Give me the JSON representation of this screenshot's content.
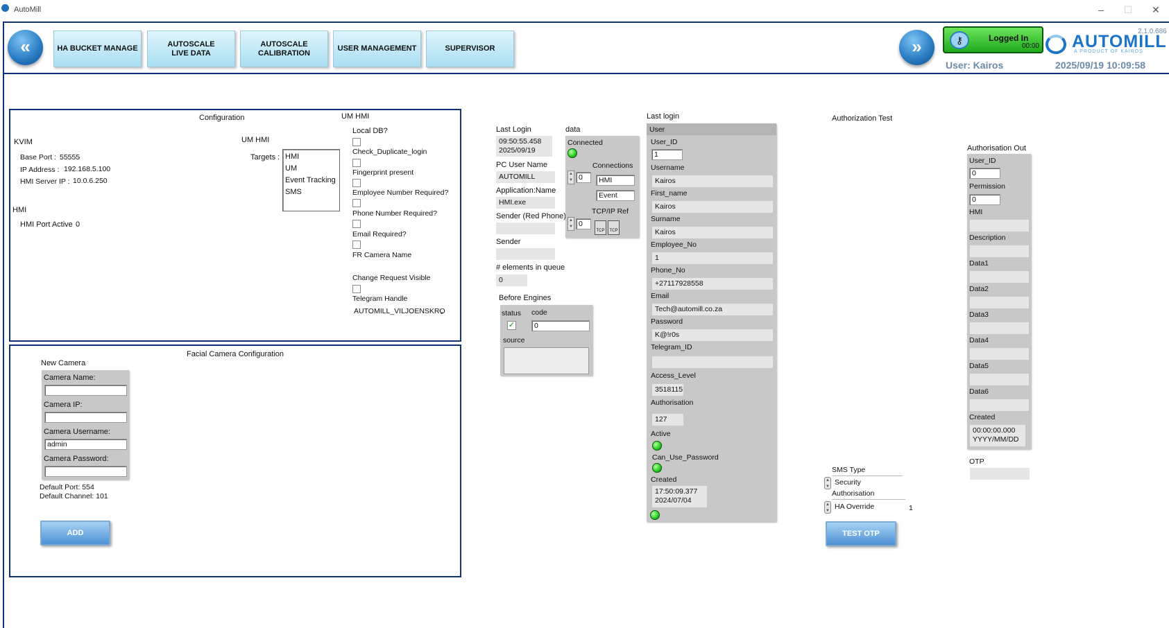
{
  "window": {
    "title": "AutoMill",
    "min": "–",
    "max": "☐",
    "close": "✕"
  },
  "header": {
    "tabs": [
      "HA BUCKET MANAGE",
      "AUTOSCALE\nLIVE DATA",
      "AUTOSCALE\nCALIBRATION",
      "USER MANAGEMENT",
      "SUPERVISOR"
    ],
    "login_status": "Logged In",
    "login_time": "00:00",
    "user_label": "User: Kairos",
    "datetime": "2025/09/19 10:09:58",
    "version": "2.1.0.686",
    "logo": "AUTOMILL",
    "logo_sub": "A PRODUCT OF KAIROS"
  },
  "config": {
    "title": "Configuration",
    "kvim": "KVIM",
    "base_port_label": "Base Port :",
    "base_port": "55555",
    "ip_label": "IP Address :",
    "ip": "192.168.5.100",
    "server_ip_label": "HMI Server IP :",
    "server_ip": "10.0.6.250",
    "hmi": "HMI",
    "hmi_port_label": "HMI Port Active",
    "hmi_port": "0",
    "um_hmi_label": "UM HMI",
    "targets_label": "Targets :",
    "targets": [
      "HMI",
      "UM",
      "Event Tracking",
      "SMS"
    ],
    "um_hmi_title": "UM HMI",
    "local_db": "Local DB?",
    "check_dup": "Check_Duplicate_login",
    "fingerprint": "Fingerprint present",
    "emp_req": "Employee Number Required?",
    "phone_req": "Phone Number Required?",
    "email_req": "Email Required?",
    "fr_cam": "FR Camera Name",
    "change_req": "Change Request Visible",
    "telegram": "Telegram Handle",
    "telegram_val": "AUTOMILL_VILJOENSKRO"
  },
  "facial": {
    "title": "Facial Camera Configuration",
    "new_camera": "New Camera",
    "cam_name": "Camera Name:",
    "cam_ip": "Camera IP:",
    "cam_user": "Camera Username:",
    "cam_user_val": "admin",
    "cam_pass": "Camera Password:",
    "default_port": "Default Port: 554",
    "default_channel": "Default Channel: 101",
    "add": "ADD"
  },
  "mid": {
    "last_login": "Last Login",
    "last_login_time": "09:50:55.458",
    "last_login_date": "2025/09/19",
    "pc_user_label": "PC User Name",
    "pc_user": "AUTOMILL",
    "app_name_label": "Application:Name",
    "app_name": "HMI.exe",
    "sender_red": "Sender (Red Phone)",
    "sender": "Sender",
    "queue_label": "# elements in queue",
    "queue": "0",
    "before_engines": "Before Engines",
    "status": "status",
    "code": "code",
    "code_val": "0",
    "source": "source",
    "check": "✓"
  },
  "data": {
    "title": "data",
    "connected": "Connected",
    "connections": "Connections",
    "conn_index": "0",
    "conn1": "HMI",
    "conn2": "Event",
    "tcp_label": "TCP/IP Ref",
    "tcp_index": "0",
    "tcp": "TCP"
  },
  "lastlogin": {
    "title": "Last login",
    "user": "User",
    "user_id_label": "User_ID",
    "user_id": "1",
    "username_label": "Username",
    "username": "Kairos",
    "first_label": "First_name",
    "first": "Kairos",
    "surname_label": "Surname",
    "surname": "Kairos",
    "emp_label": "Employee_No",
    "emp": "1",
    "phone_label": "Phone_No",
    "phone": "+27117928558",
    "email_label": "Email",
    "email": "Tech@automill.co.za",
    "pass_label": "Password",
    "pass": "K@!r0s",
    "tg_label": "Telegram_ID",
    "access_label": "Access_Level",
    "access": "3518115",
    "auth_label": "Authorisation",
    "auth": "127",
    "active_label": "Active",
    "canuse_label": "Can_Use_Password",
    "created_label": "Created",
    "created_time": "17:50:09.377",
    "created_date": "2024/07/04"
  },
  "authtest": {
    "title": "Authorization Test",
    "sms_type": "SMS Type",
    "sms_val": "Security",
    "auth": "Authorisation",
    "auth_val": "HA Override",
    "auth_num": "1",
    "test_otp": "TEST OTP"
  },
  "authout": {
    "title": "Authorisation Out",
    "user_id_label": "User_ID",
    "user_id": "0",
    "perm_label": "Permission",
    "perm": "0",
    "hmi": "HMI",
    "desc": "Description",
    "d1": "Data1",
    "d2": "Data2",
    "d3": "Data3",
    "d4": "Data4",
    "d5": "Data5",
    "d6": "Data6",
    "created": "Created",
    "created_time": "00:00:00.000",
    "created_date": "YYYY/MM/DD",
    "otp": "OTP"
  }
}
